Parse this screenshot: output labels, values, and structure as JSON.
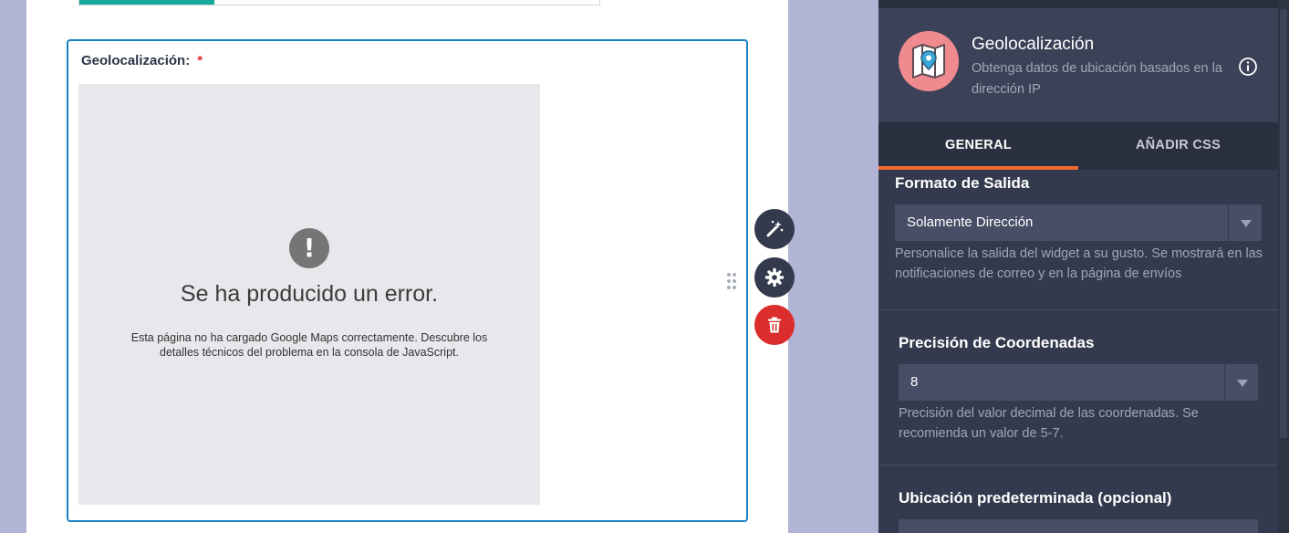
{
  "form": {
    "progress_percent": 26,
    "field": {
      "label": "Geolocalización:",
      "required_mark": "*"
    },
    "map_error": {
      "icon_glyph": "!",
      "title": "Se ha producido un error.",
      "description": "Esta página no ha cargado Google Maps correctamente. Descubre los detalles técnicos del problema en la consola de JavaScript."
    },
    "side_actions": [
      "wand-icon",
      "gear-icon",
      "trash-icon"
    ]
  },
  "panel": {
    "widget": {
      "title": "Geolocalización",
      "description": "Obtenga datos de ubicación basados en la dirección IP"
    },
    "tabs": [
      {
        "label": "GENERAL",
        "active": true
      },
      {
        "label": "AÑADIR CSS",
        "active": false
      }
    ],
    "output_format": {
      "label": "Formato de Salida",
      "value": "Solamente Dirección",
      "help": "Personalice la salida del widget a su gusto. Se mostrará en las notificaciones de correo y en la página de envíos"
    },
    "precision": {
      "label": "Precisión de Coordenadas",
      "value": "8",
      "help": "Precisión del valor decimal de las coordenadas. Se recomienda un valor de 5-7."
    },
    "default_location": {
      "label": "Ubicación predeterminada (opcional)"
    }
  },
  "colors": {
    "accent_teal": "#16a89a",
    "field_border": "#1a82c4",
    "tab_underline": "#f16a2d",
    "delete_red": "#dc2d2d",
    "panel_bg": "#343a4e"
  }
}
